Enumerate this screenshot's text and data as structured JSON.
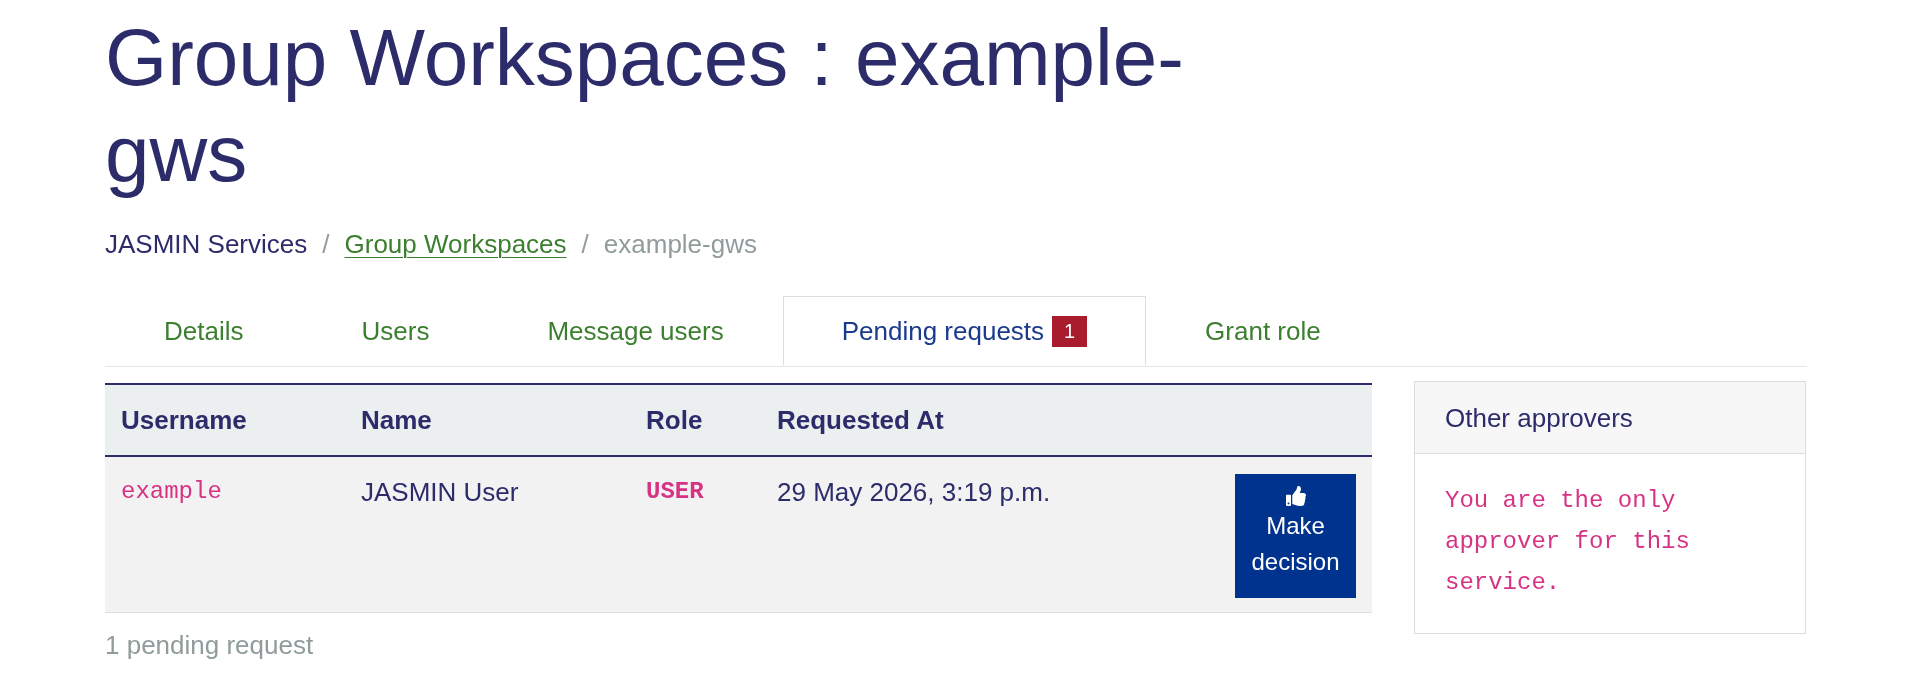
{
  "page_title": "Group Workspaces : example-gws",
  "breadcrumb": [
    {
      "label": "JASMIN Services",
      "kind": "plain"
    },
    {
      "separator": "/",
      "label": "Group Workspaces",
      "kind": "link"
    },
    {
      "separator": "/",
      "label": "example-gws",
      "kind": "current"
    }
  ],
  "tabs": [
    {
      "label": "Details",
      "selected": false
    },
    {
      "label": "Users",
      "selected": false
    },
    {
      "label": "Message users",
      "selected": false
    },
    {
      "label": "Pending requests",
      "selected": true,
      "badge": "1"
    },
    {
      "label": "Grant role",
      "selected": false
    }
  ],
  "requests_table": {
    "columns": [
      "Username",
      "Name",
      "Role",
      "Requested At"
    ],
    "rows": [
      {
        "username": "example",
        "name": "JASMIN User",
        "role": "USER",
        "requested_at": "29 May 2026, 3:19 p.m.",
        "action": "Make decision"
      }
    ]
  },
  "pending_count": "1 pending request",
  "approvers_panel": {
    "title": "Other approvers",
    "message": "You are the only approver for this service."
  }
}
